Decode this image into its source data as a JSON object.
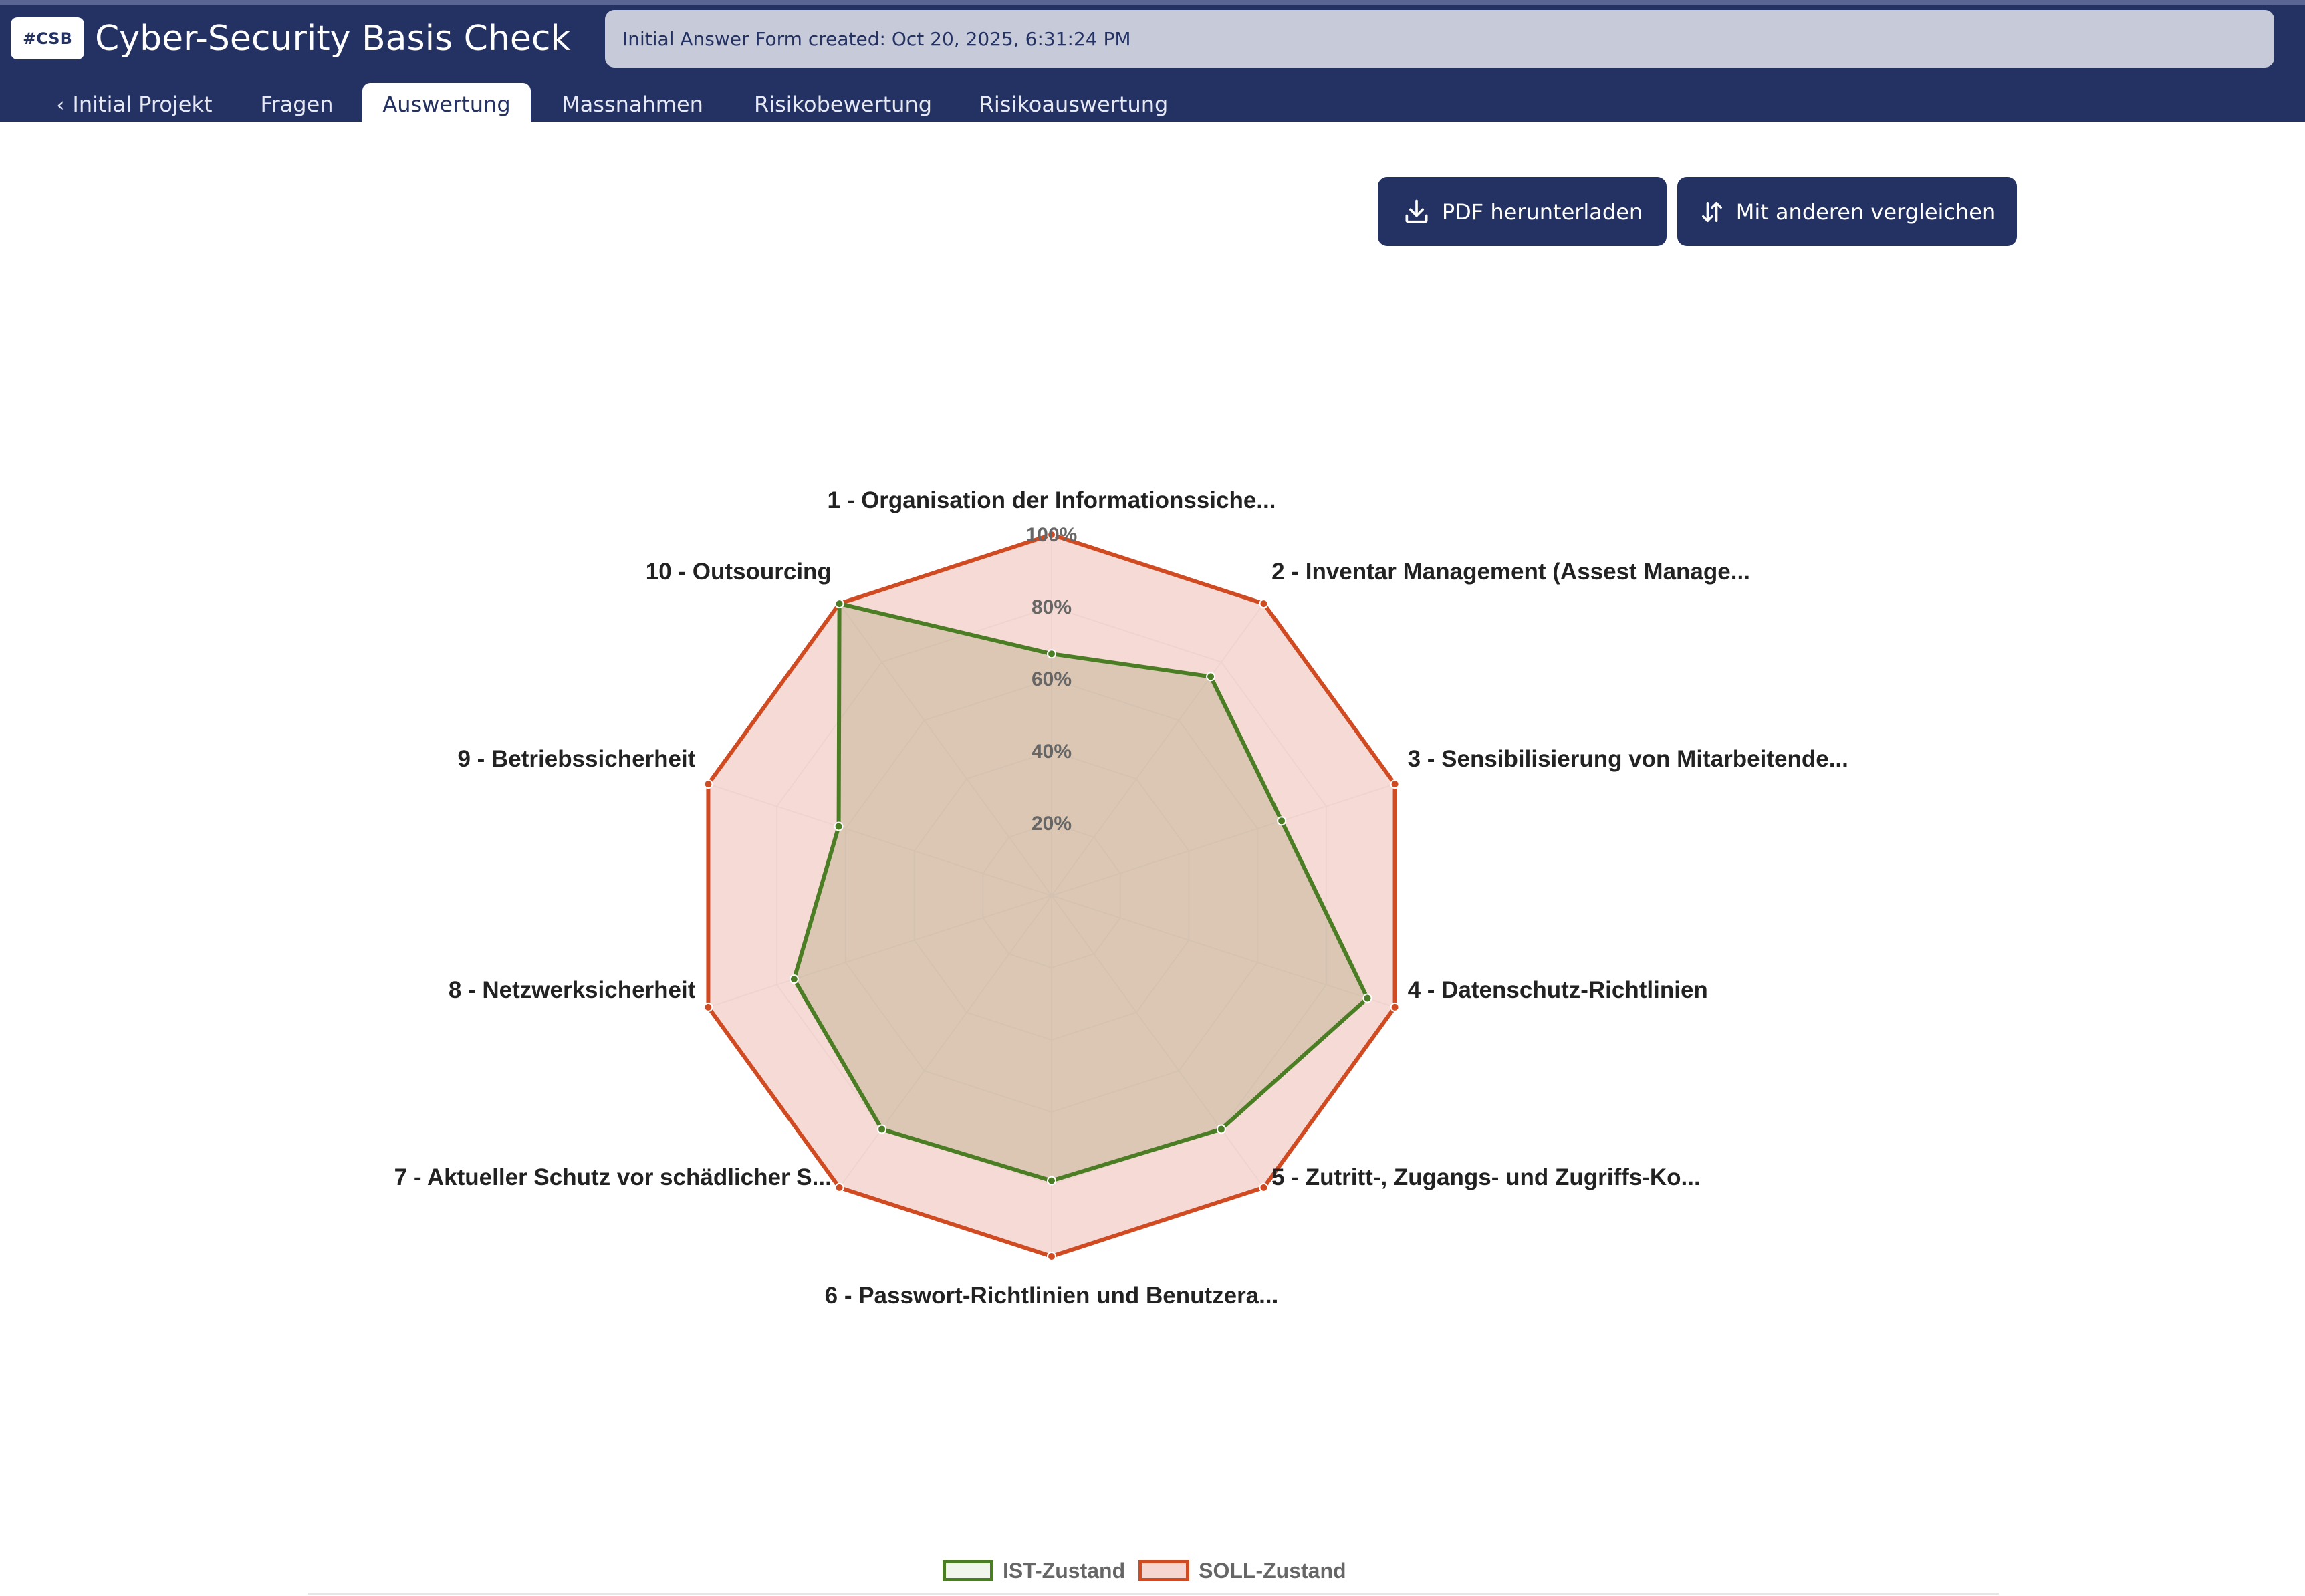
{
  "header": {
    "logo_text": "#CSB",
    "title": "Cyber-Security Basis Check",
    "info": "Initial Answer Form created: Oct 20, 2025, 6:31:24 PM"
  },
  "tabs": [
    {
      "label": "Initial Projekt",
      "icon": "chevron-left-icon"
    },
    {
      "label": "Fragen"
    },
    {
      "label": "Auswertung",
      "active": true
    },
    {
      "label": "Massnahmen"
    },
    {
      "label": "Risikobewertung"
    },
    {
      "label": "Risikoauswertung"
    }
  ],
  "actions": {
    "pdf_label": "PDF herunterladen",
    "pdf_icon": "download-icon",
    "compare_label": "Mit anderen vergleichen",
    "compare_icon": "sort-arrows-icon"
  },
  "colors": {
    "header_bg": "#233163",
    "ist": "#4a7d24",
    "soll": "#d04a22",
    "soll_fill": "#f5d6d0"
  },
  "chart_data": {
    "type": "radar",
    "categories": [
      "1 - Organisation der Informationssiche...",
      "2 - Inventar Management (Assest Manage...",
      "3 - Sensibilisierung von Mitarbeitende...",
      "4 - Datenschutz-Richtlinien",
      "5 - Zutritt-, Zugangs- und Zugriffs-Ko...",
      "6 - Passwort-Richtlinien und Benutzera...",
      "7 - Aktueller Schutz vor schädlicher S...",
      "8 - Netzwerksicherheit",
      "9 - Betriebssicherheit",
      "10 - Outsourcing"
    ],
    "series": [
      {
        "name": "IST-Zustand",
        "values": [
          67,
          75,
          67,
          92,
          80,
          79,
          80,
          75,
          62,
          100
        ]
      },
      {
        "name": "SOLL-Zustand",
        "values": [
          100,
          100,
          100,
          100,
          100,
          100,
          100,
          100,
          100,
          100
        ]
      }
    ],
    "ticks": [
      "20%",
      "40%",
      "60%",
      "80%",
      "100%"
    ],
    "rlim": [
      0,
      100
    ],
    "grid": true,
    "legend_position": "bottom"
  }
}
